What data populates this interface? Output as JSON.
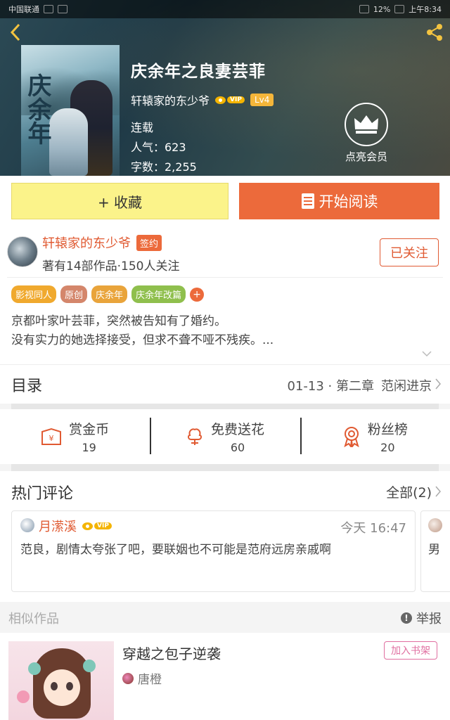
{
  "statusbar": {
    "carrier": "中国联通",
    "battery": "12%",
    "time": "上午8:34"
  },
  "book": {
    "title": "庆余年之良妻芸菲",
    "author": "轩辕家的东少爷",
    "vip_label": "VIP",
    "level": "Lv4",
    "status": "连载",
    "popularity_label": "人气：623",
    "wordcount_label": "字数：2,255",
    "cover_text": "庆余年"
  },
  "member": {
    "label": "点亮会员"
  },
  "actions": {
    "favorite": "+ 收藏",
    "read": "开始阅读"
  },
  "author_block": {
    "name": "轩辕家的东少爷",
    "sign_badge": "签约",
    "stats": "著有14部作品·150人关注",
    "follow": "已关注"
  },
  "tags": [
    {
      "label": "影视同人",
      "color": "#f0a92e"
    },
    {
      "label": "原创",
      "color": "#d4866b"
    },
    {
      "label": "庆余年",
      "color": "#e9a43b"
    },
    {
      "label": "庆余年改篇",
      "color": "#8fbf4d"
    }
  ],
  "intro": {
    "line1": "京都叶家叶芸菲，突然被告知有了婚约。",
    "line2": "没有实力的她选择接受，但求不聋不哑不残疾。..."
  },
  "catalog": {
    "title": "目录",
    "latest_date": "01-13 · 第二章",
    "latest_title": "范闲进京"
  },
  "rewards": [
    {
      "label": "赏金币",
      "value": "19",
      "icon": "coin-envelope-icon"
    },
    {
      "label": "免费送花",
      "value": "60",
      "icon": "flower-icon"
    },
    {
      "label": "粉丝榜",
      "value": "20",
      "icon": "medal-icon"
    }
  ],
  "comments": {
    "title": "热门评论",
    "all": "全部(2)",
    "items": [
      {
        "user": "月潆溪",
        "vip": "VIP",
        "time": "今天 16:47",
        "text": "范良，剧情太夸张了吧，要联姻也不可能是范府远房亲戚啊"
      },
      {
        "text": "男"
      }
    ]
  },
  "similar": {
    "title": "相似作品",
    "report": "举报",
    "item": {
      "title": "穿越之包子逆袭",
      "author": "唐橙",
      "shelf": "加入书架"
    }
  },
  "colors": {
    "accent": "#ec6a3b",
    "favorite_bg": "#fbf38a",
    "vip": "#f4b400"
  }
}
